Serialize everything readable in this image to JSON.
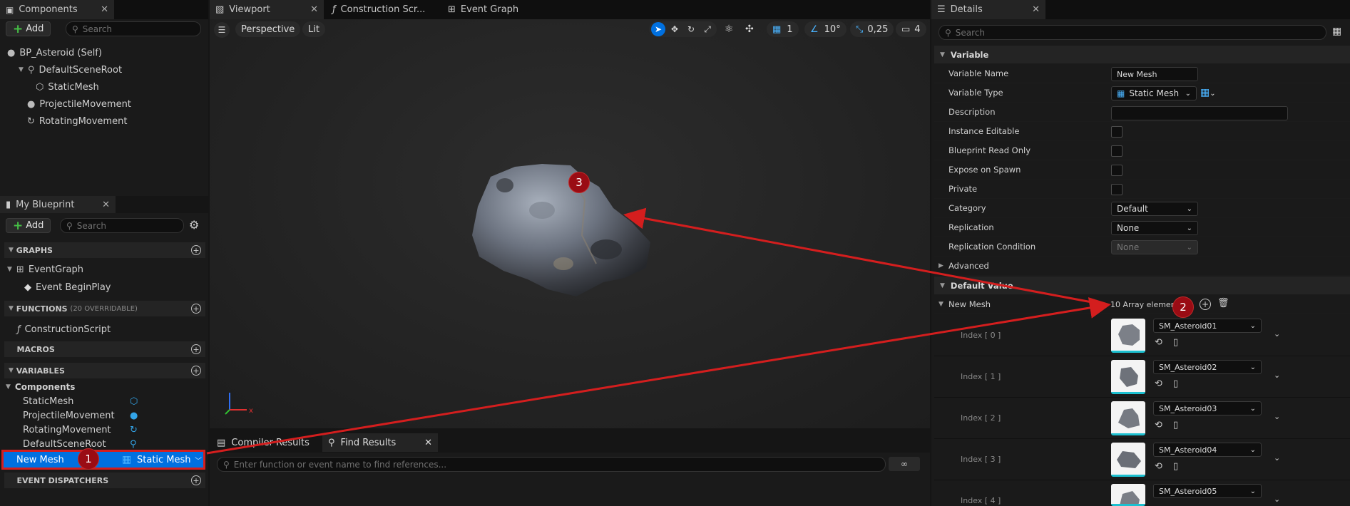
{
  "components_panel": {
    "tab_label": "Components",
    "add_label": "Add",
    "search_placeholder": "Search",
    "tree": [
      {
        "label": "BP_Asteroid (Self)"
      },
      {
        "label": "DefaultSceneRoot"
      },
      {
        "label": "StaticMesh"
      },
      {
        "label": "ProjectileMovement"
      },
      {
        "label": "RotatingMovement"
      }
    ]
  },
  "my_blueprint": {
    "tab_label": "My Blueprint",
    "add_label": "Add",
    "search_placeholder": "Search",
    "graphs_label": "GRAPHS",
    "event_graph": "EventGraph",
    "event_begin_play": "Event BeginPlay",
    "functions_label": "FUNCTIONS",
    "functions_note": "(20 OVERRIDABLE)",
    "construction_script": "ConstructionScript",
    "macros_label": "MACROS",
    "variables_label": "VARIABLES",
    "components_group": "Components",
    "variable_items": [
      "StaticMesh",
      "ProjectileMovement",
      "RotatingMovement",
      "DefaultSceneRoot"
    ],
    "selected_var": {
      "name": "New Mesh",
      "type": "Static Mesh"
    },
    "event_dispatchers_label": "EVENT DISPATCHERS"
  },
  "editor_tabs": {
    "viewport": "Viewport",
    "construction": "Construction Scr...",
    "event_graph": "Event Graph"
  },
  "viewport": {
    "perspective": "Perspective",
    "lit": "Lit",
    "grid_value": "1",
    "angle_value": "10°",
    "scale_value": "0,25",
    "camera_value": "4"
  },
  "bottom_panel": {
    "compiler_results": "Compiler Results",
    "find_results": "Find Results",
    "find_placeholder": "Enter function or event name to find references..."
  },
  "details": {
    "tab_label": "Details",
    "search_placeholder": "Search",
    "variable_section": "Variable",
    "rows": {
      "variable_name_label": "Variable Name",
      "variable_name_value": "New Mesh",
      "variable_type_label": "Variable Type",
      "variable_type_value": "Static Mesh",
      "description_label": "Description",
      "instance_editable_label": "Instance Editable",
      "blueprint_read_only_label": "Blueprint Read Only",
      "expose_on_spawn_label": "Expose on Spawn",
      "private_label": "Private",
      "category_label": "Category",
      "category_value": "Default",
      "replication_label": "Replication",
      "replication_value": "None",
      "replication_condition_label": "Replication Condition",
      "replication_condition_value": "None"
    },
    "advanced_label": "Advanced",
    "default_value_section": "Default Value",
    "array_label": "New Mesh",
    "array_count": "10 Array elements",
    "elements": [
      {
        "index": "Index [ 0 ]",
        "asset": "SM_Asteroid01"
      },
      {
        "index": "Index [ 1 ]",
        "asset": "SM_Asteroid02"
      },
      {
        "index": "Index [ 2 ]",
        "asset": "SM_Asteroid03"
      },
      {
        "index": "Index [ 3 ]",
        "asset": "SM_Asteroid04"
      },
      {
        "index": "Index [ 4 ]",
        "asset": "SM_Asteroid05"
      }
    ]
  },
  "markers": [
    "1",
    "2",
    "3"
  ],
  "colors": {
    "selection_blue": "#0070e0",
    "annotation_red": "#d41e1e",
    "marker_fill": "#9a0c14",
    "accent_cyan": "#1cc0d0"
  }
}
